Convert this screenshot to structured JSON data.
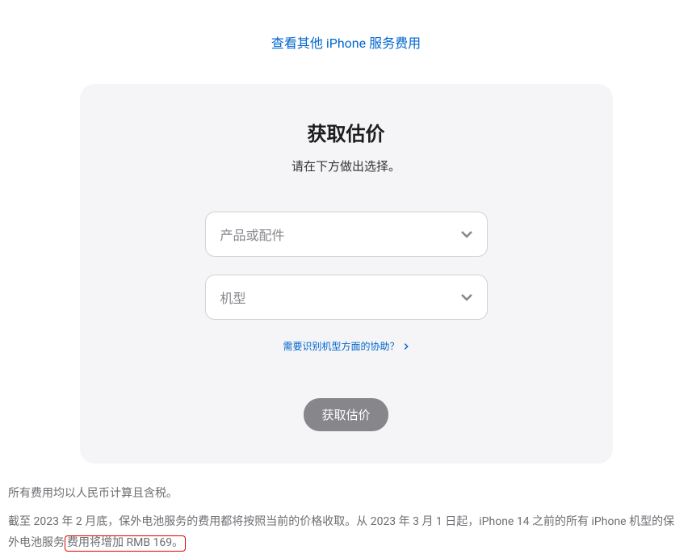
{
  "topLink": "查看其他 iPhone 服务费用",
  "card": {
    "title": "获取估价",
    "subtitle": "请在下方做出选择。",
    "select1Placeholder": "产品或配件",
    "select2Placeholder": "机型",
    "helpLink": "需要识别机型方面的协助？",
    "buttonLabel": "获取估价"
  },
  "footer": {
    "line1": "所有费用均以人民币计算且含税。",
    "line2Before": "截至 2023 年 2 月底，保外电池服务的费用都将按照当前的价格收取。从 2023 年 3 月 1 日起，iPhone 14 之前的所有 iPhone 机型的保外电池服务",
    "line2Highlight": "费用将增加 RMB 169。"
  }
}
